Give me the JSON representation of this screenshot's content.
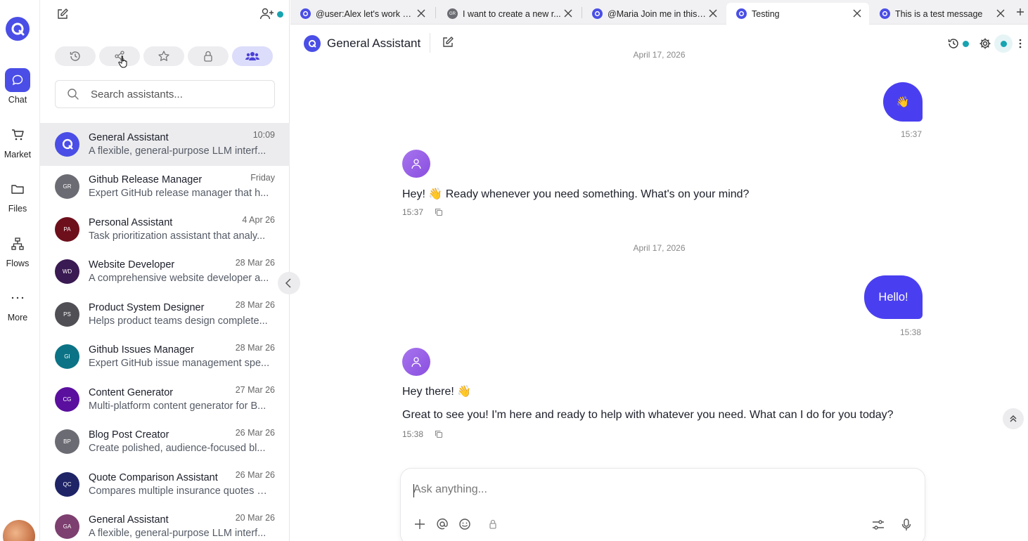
{
  "rail": {
    "items": [
      {
        "label": "Chat"
      },
      {
        "label": "Market"
      },
      {
        "label": "Files"
      },
      {
        "label": "Flows"
      },
      {
        "label": "More"
      }
    ]
  },
  "sidebar": {
    "search_placeholder": "Search assistants...",
    "items": [
      {
        "name": "General Assistant",
        "desc": "A flexible, general-purpose LLM interf...",
        "time": "10:09",
        "initials": "",
        "color": "#4a4ee6"
      },
      {
        "name": "Github Release Manager",
        "desc": "Expert GitHub release manager that h...",
        "time": "Friday",
        "initials": "GR",
        "color": "#6b6b73"
      },
      {
        "name": "Personal Assistant",
        "desc": "Task prioritization assistant that analy...",
        "time": "4 Apr 26",
        "initials": "PA",
        "color": "#6e0f1c"
      },
      {
        "name": "Website Developer",
        "desc": "A comprehensive website developer a...",
        "time": "28 Mar 26",
        "initials": "WD",
        "color": "#3a1a52"
      },
      {
        "name": "Product System Designer",
        "desc": "Helps product teams design complete...",
        "time": "28 Mar 26",
        "initials": "PS",
        "color": "#4f4f55"
      },
      {
        "name": "Github Issues Manager",
        "desc": "Expert GitHub issue management spe...",
        "time": "28 Mar 26",
        "initials": "GI",
        "color": "#0b7385"
      },
      {
        "name": "Content Generator",
        "desc": "Multi-platform content generator for B...",
        "time": "27 Mar 26",
        "initials": "CG",
        "color": "#5a0f9e"
      },
      {
        "name": "Blog Post Creator",
        "desc": "Create polished, audience-focused bl...",
        "time": "26 Mar 26",
        "initials": "BP",
        "color": "#6b6b73"
      },
      {
        "name": "Quote Comparison Assistant",
        "desc": "Compares multiple insurance quotes s...",
        "time": "26 Mar 26",
        "initials": "QC",
        "color": "#1e2466"
      },
      {
        "name": "General Assistant",
        "desc": "A flexible, general-purpose LLM interf...",
        "time": "20 Mar 26",
        "initials": "GA",
        "color": "#7d3f6f"
      }
    ]
  },
  "tabs": [
    {
      "title": "@user:Alex let's work o...",
      "initials": ""
    },
    {
      "title": "I want to create a new r...",
      "initials": "GR"
    },
    {
      "title": "@Maria Join me in this ...",
      "initials": ""
    },
    {
      "title": "Testing",
      "initials": ""
    },
    {
      "title": "This is a test message",
      "initials": ""
    }
  ],
  "header": {
    "title": "General Assistant"
  },
  "messages": {
    "date1": "April 17, 2026",
    "me1": "👋",
    "me1_time": "15:37",
    "bot1": "Hey! 👋 Ready whenever you need something. What's on your mind?",
    "bot1_time": "15:37",
    "date2": "April 17, 2026",
    "me2": "Hello!",
    "me2_time": "15:38",
    "bot2_line1": "Hey there! 👋",
    "bot2_line2": "Great to see you! I'm here and ready to help with whatever you need. What can I do for you today?",
    "bot2_time": "15:38"
  },
  "composer": {
    "placeholder": "Ask anything..."
  },
  "colors": {
    "accent": "#4a4ee6",
    "bubble": "#4a3ff0",
    "status_dot": "#17a3b0"
  }
}
